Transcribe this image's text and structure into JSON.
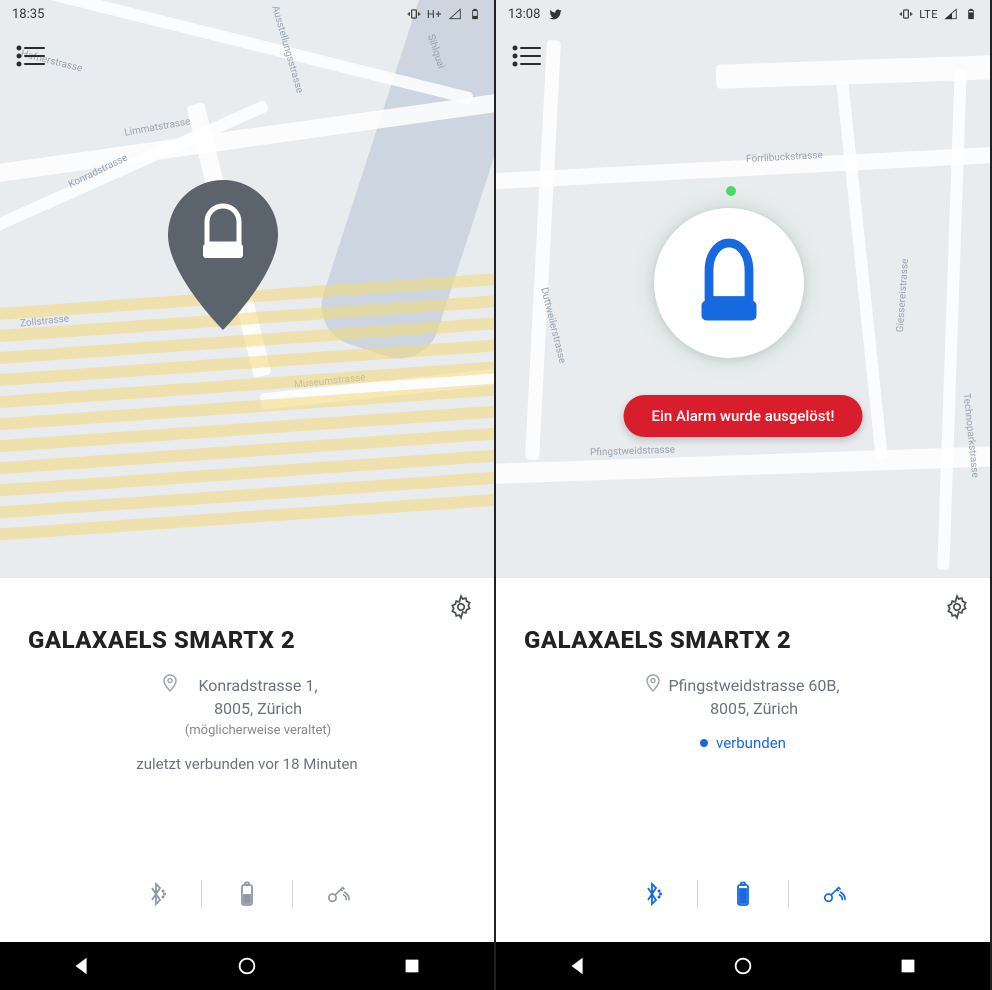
{
  "left": {
    "status_bar": {
      "time": "18:35",
      "network_label": "H+",
      "twitter": false
    },
    "menu_icon": "menu-icon",
    "marker_icon": "u-lock-icon",
    "map_streets": [
      "Hafnerstrasse",
      "Konradstrasse",
      "Limmatstrasse",
      "Ausstellungsstrasse",
      "Sihlquai",
      "Zollstrasse",
      "Museumstrasse"
    ],
    "device_title": "GALAXAELS SMARTX 2",
    "address_line1": "Konradstrasse 1,",
    "address_line2": "8005, Zürich",
    "address_hint": "(möglicherweise veraltet)",
    "status_text": "zuletzt verbunden vor 18 Minuten",
    "icons": {
      "bluetooth": "bluetooth-icon",
      "battery": "battery-icon",
      "key": "key-signal-icon"
    },
    "icon_color": "gray"
  },
  "right": {
    "status_bar": {
      "time": "13:08",
      "network_label": "LTE",
      "twitter": true
    },
    "menu_icon": "menu-icon",
    "marker_icon": "u-lock-icon",
    "map_streets": [
      "Förrlibuckstrasse",
      "Duttweilerstrasse",
      "Giessereistrasse",
      "Pfingstweidstrasse",
      "Technoparkstrasse"
    ],
    "alert_text": "Ein Alarm wurde ausgelöst!",
    "device_title": "GALAXAELS SMARTX 2",
    "address_line1": "Pfingstweidstrasse 60B,",
    "address_line2": "8005, Zürich",
    "status_text": "verbunden",
    "icons": {
      "bluetooth": "bluetooth-icon",
      "battery": "battery-icon",
      "key": "key-signal-icon"
    },
    "icon_color": "blue"
  },
  "nav_buttons": [
    "back",
    "home",
    "recent"
  ]
}
